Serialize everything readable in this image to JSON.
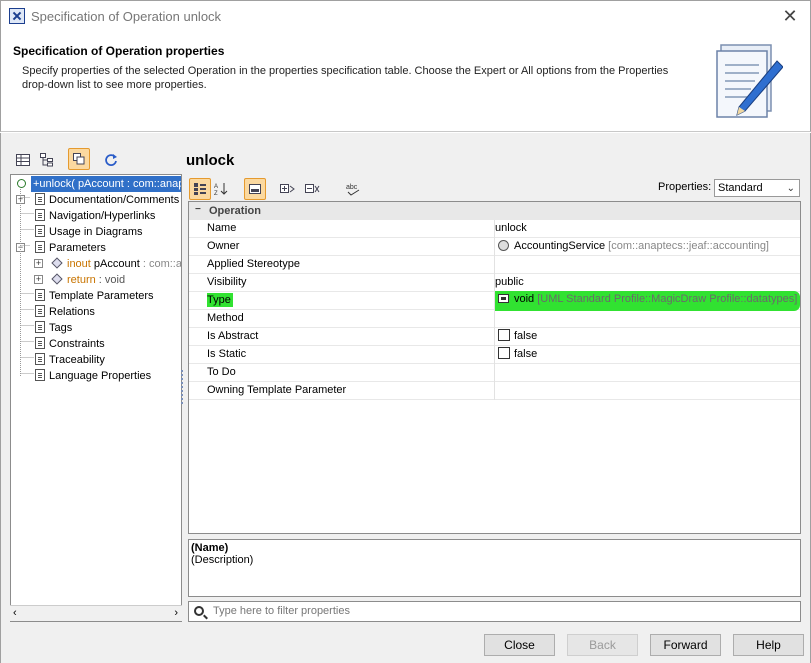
{
  "window": {
    "title": "Specification of Operation unlock",
    "close_glyph": "✕"
  },
  "header": {
    "title": "Specification of Operation properties",
    "description": "Specify properties of the selected Operation in the properties specification table. Choose the Expert or All options from the Properties drop-down list to see more properties."
  },
  "tree": {
    "selected_label": "+unlock( pAccount : com::anaptecs::jeaf::accounting::Account",
    "items": [
      {
        "label": "Documentation/Comments",
        "expandable": true
      },
      {
        "label": "Navigation/Hyperlinks",
        "expandable": false
      },
      {
        "label": "Usage in Diagrams",
        "expandable": false
      },
      {
        "label": "Parameters",
        "expandable": true
      },
      {
        "label": "Template Parameters",
        "expandable": false
      },
      {
        "label": "Relations",
        "expandable": false
      },
      {
        "label": "Tags",
        "expandable": false
      },
      {
        "label": "Constraints",
        "expandable": false
      },
      {
        "label": "Traceability",
        "expandable": false
      },
      {
        "label": "Language Properties",
        "expandable": false
      }
    ],
    "params": [
      {
        "direction": "inout",
        "name": "pAccount",
        "type": " : com::anaptecs"
      },
      {
        "direction": "return",
        "name": "",
        "type": " : void"
      }
    ]
  },
  "element_name": "unlock",
  "properties_filter": {
    "label": "Properties:",
    "selected": "Standard"
  },
  "table": {
    "group": "Operation",
    "rows": [
      {
        "name": "Name",
        "value": "unlock",
        "value_kind": "text"
      },
      {
        "name": "Owner",
        "value": "AccountingService",
        "qualifier": "[com::anaptecs::jeaf::accounting]",
        "value_kind": "class"
      },
      {
        "name": "Applied Stereotype",
        "value": "",
        "value_kind": "text"
      },
      {
        "name": "Visibility",
        "value": "public",
        "value_kind": "text"
      },
      {
        "name": "Type",
        "value": "void",
        "qualifier": "[UML Standard Profile::MagicDraw Profile::datatypes]",
        "value_kind": "datatype",
        "highlighted": true
      },
      {
        "name": "Method",
        "value": "",
        "value_kind": "text"
      },
      {
        "name": "Is Abstract",
        "value": "false",
        "value_kind": "checkbox"
      },
      {
        "name": "Is Static",
        "value": "false",
        "value_kind": "checkbox"
      },
      {
        "name": "To Do",
        "value": "",
        "value_kind": "text"
      },
      {
        "name": "Owning Template Parameter",
        "value": "",
        "value_kind": "text"
      }
    ]
  },
  "description_pane": {
    "name": "(Name)",
    "description": "(Description)"
  },
  "filter": {
    "placeholder": "Type here to filter properties"
  },
  "buttons": {
    "close": "Close",
    "back": "Back",
    "forward": "Forward",
    "help": "Help"
  },
  "colors": {
    "highlight": "#31e231",
    "selection": "#3070c8",
    "active_tool": "#fbd9a0"
  }
}
